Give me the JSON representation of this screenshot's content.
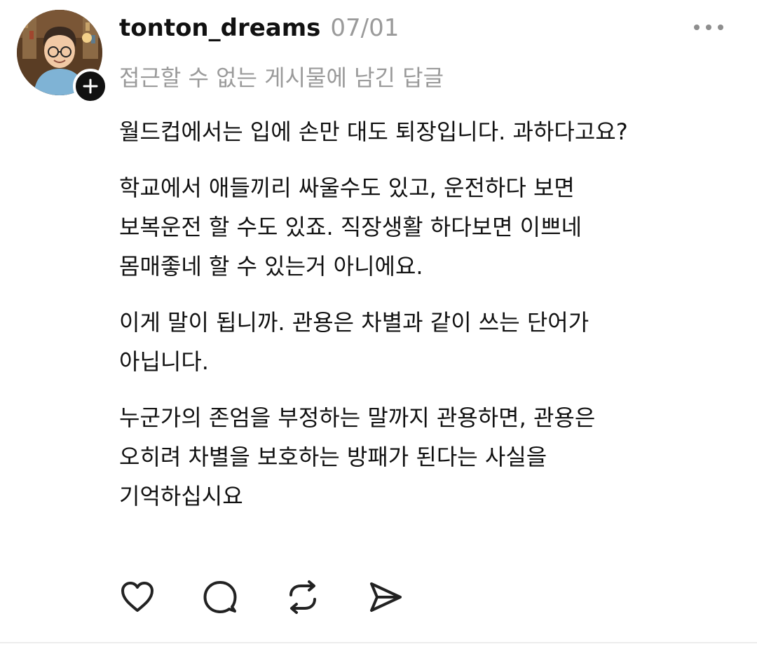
{
  "post": {
    "username": "tonton_dreams",
    "timestamp": "07/01",
    "reply_context": "접근할 수 없는 게시물에 남긴 답글",
    "paragraphs": [
      {
        "lines": [
          "월드컵에서는 입에 손만 대도 퇴장입니다. 과하다고요?"
        ]
      },
      {
        "lines": [
          "학교에서 애들끼리 싸울수도 있고, 운전하다 보면",
          "보복운전 할 수도 있죠. 직장생활 하다보면 이쁘네",
          "몸매좋네 할 수 있는거 아니에요."
        ]
      },
      {
        "lines": [
          "이게 말이 됩니까. 관용은 차별과 같이 쓰는 단어가",
          "아닙니다."
        ]
      },
      {
        "lines": [
          "누군가의 존엄을 부정하는 말까지 관용하면, 관용은",
          "오히려 차별을 보호하는 방패가 된다는 사실을",
          "기억하십시요"
        ]
      }
    ]
  },
  "icons": {
    "avatar": "avatar-image",
    "follow": "plus-icon",
    "more": "more-horizontal-icon",
    "like": "heart-icon",
    "reply": "comment-bubble-icon",
    "repost": "repost-icon",
    "share": "send-icon"
  },
  "colors": {
    "text": "#111111",
    "secondary": "#9a9a9a",
    "divider": "#ececec",
    "badge": "#111111"
  }
}
